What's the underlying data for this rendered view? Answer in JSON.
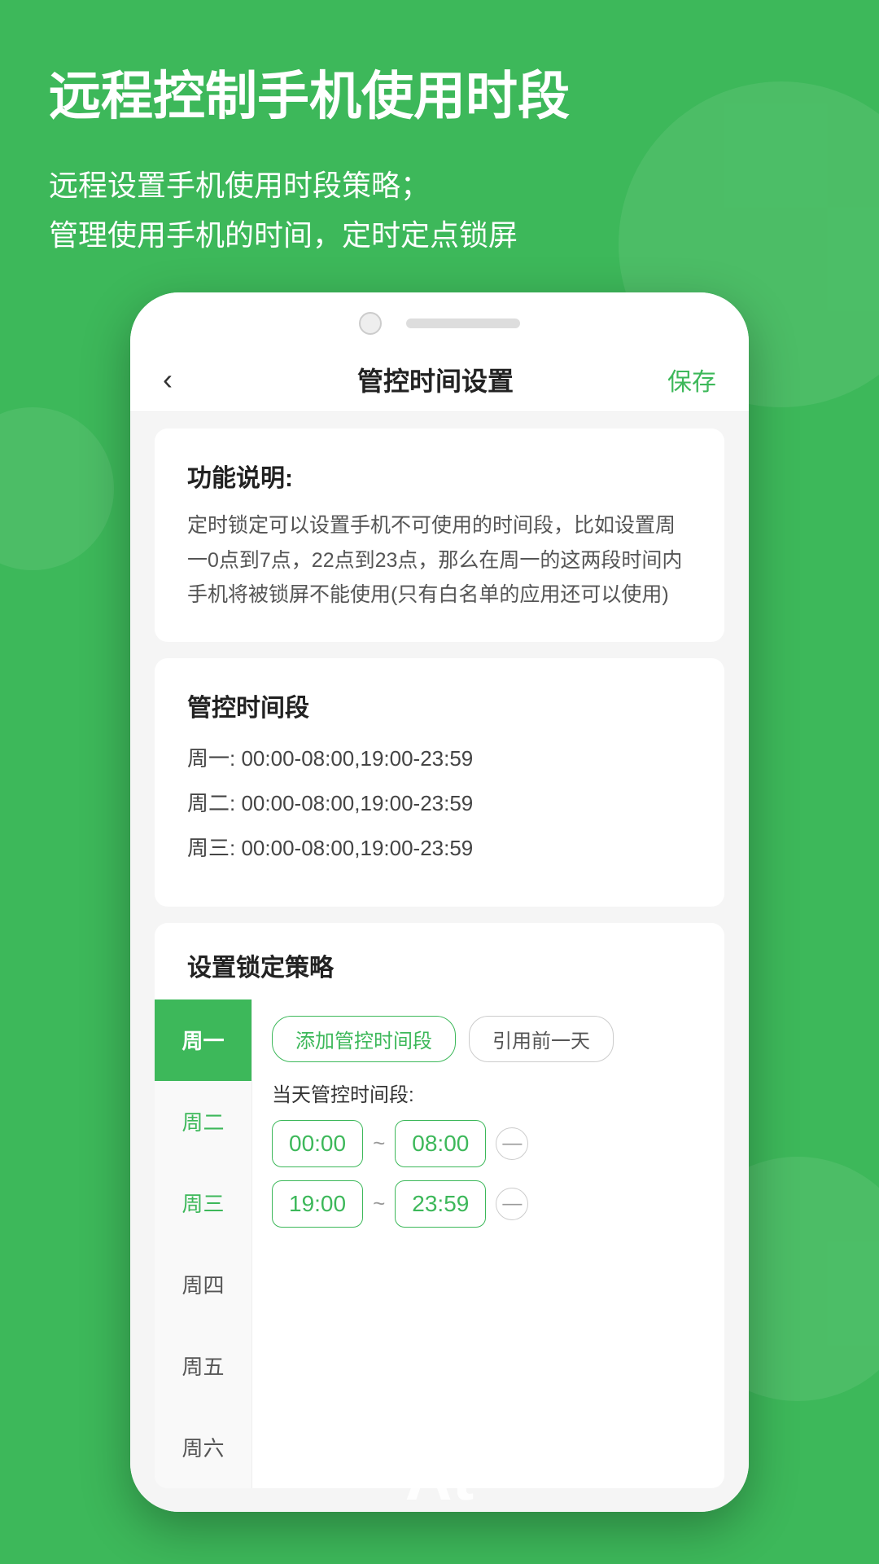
{
  "background": {
    "color": "#3db85a"
  },
  "header": {
    "title": "远程控制手机使用时段",
    "description_line1": "远程设置手机使用时段策略；",
    "description_line2": "管理使用手机的时间，定时定点锁屏"
  },
  "nav": {
    "back_icon": "‹",
    "title": "管控时间设置",
    "save_label": "保存"
  },
  "feature_card": {
    "title": "功能说明:",
    "description": "定时锁定可以设置手机不可使用的时间段，比如设置周一0点到7点，22点到23点，那么在周一的这两段时间内手机将被锁屏不能使用(只有白名单的应用还可以使用)"
  },
  "schedule_card": {
    "title": "管控时间段",
    "rows": [
      {
        "day": "周一:",
        "times": "00:00-08:00,19:00-23:59"
      },
      {
        "day": "周二:",
        "times": "00:00-08:00,19:00-23:59"
      },
      {
        "day": "周三:",
        "times": "00:00-08:00,19:00-23:59"
      }
    ]
  },
  "strategy_card": {
    "title": "设置锁定策略",
    "days": [
      {
        "label": "周一",
        "state": "active"
      },
      {
        "label": "周二",
        "state": "highlight"
      },
      {
        "label": "周三",
        "state": "highlight"
      },
      {
        "label": "周四",
        "state": "normal"
      },
      {
        "label": "周五",
        "state": "normal"
      },
      {
        "label": "周六",
        "state": "normal"
      }
    ],
    "add_time_btn": "添加管控时间段",
    "copy_prev_btn": "引用前一天",
    "current_period_label": "当天管控时间段:",
    "time_ranges": [
      {
        "start": "00:00",
        "end": "08:00"
      },
      {
        "start": "19:00",
        "end": "23:59"
      }
    ]
  },
  "bottom": {
    "at_text": "At"
  }
}
